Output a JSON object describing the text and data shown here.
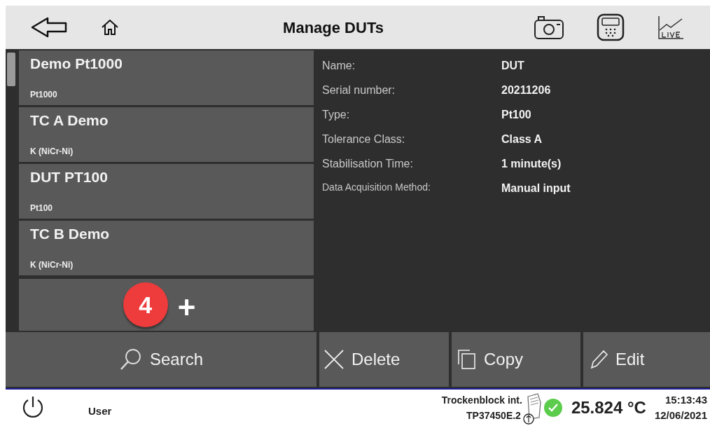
{
  "header": {
    "title": "Manage DUTs"
  },
  "dut_list": [
    {
      "name": "Demo Pt1000",
      "type": "Pt1000"
    },
    {
      "name": "TC A Demo",
      "type": "K (NiCr-Ni)"
    },
    {
      "name": "DUT PT100",
      "type": "Pt100"
    },
    {
      "name": "TC B Demo",
      "type": "K (NiCr-Ni)"
    }
  ],
  "add_button": {
    "badge": "4",
    "label": "+"
  },
  "details": [
    {
      "label": "Name:",
      "value": "DUT"
    },
    {
      "label": "Serial number:",
      "value": "20211206"
    },
    {
      "label": "Type:",
      "value": "Pt100"
    },
    {
      "label": "Tolerance Class:",
      "value": "Class A"
    },
    {
      "label": "Stabilisation Time:",
      "value": "1 minute(s)"
    },
    {
      "label": "Data Acquisition Method:",
      "value": "Manual input"
    }
  ],
  "actions": [
    {
      "kind": "search",
      "label": "Search"
    },
    {
      "kind": "delete",
      "label": "Delete"
    },
    {
      "kind": "copy",
      "label": "Copy"
    },
    {
      "kind": "edit",
      "label": "Edit"
    }
  ],
  "status_bar": {
    "user": "User",
    "device": "Trockenblock int.",
    "device_id": "TP37450E.2",
    "connected": true,
    "temperature": "25.824 °C",
    "time": "15:13:43",
    "date": "12/06/2021"
  }
}
